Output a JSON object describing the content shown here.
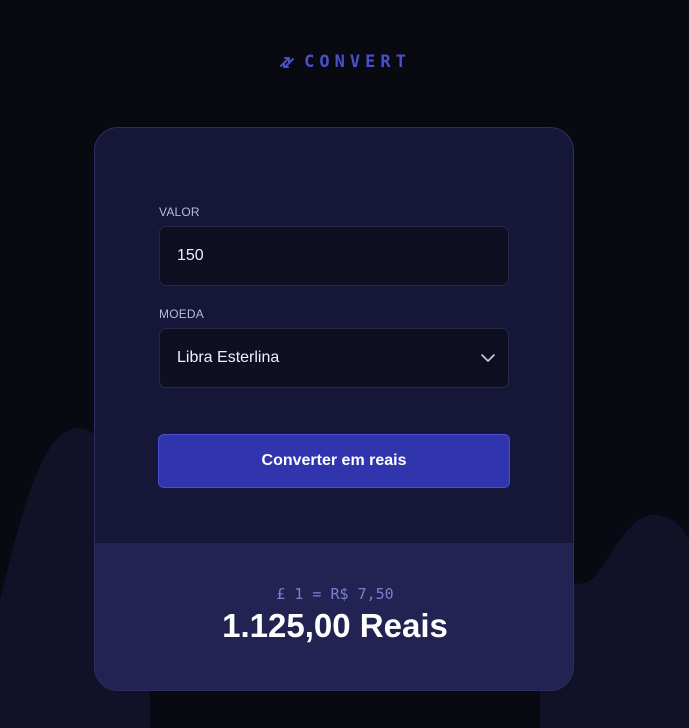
{
  "header": {
    "brand_icon": "swap-arrows-icon",
    "brand_name": "CONVERT"
  },
  "form": {
    "amount_label": "VALOR",
    "amount_value": "150",
    "currency_label": "MOEDA",
    "currency_selected": "Libra Esterlina",
    "currency_dropdown_icon": "chevron-down-icon",
    "convert_button_label": "Converter em reais"
  },
  "result": {
    "rate_text": "£ 1 = R$ 7,50",
    "total_text": "1.125,00 Reais"
  },
  "colors": {
    "background": "#090912",
    "card": "#161738",
    "accent": "#3135ad",
    "brand": "#4a4ec9",
    "result_panel": "#222352"
  }
}
